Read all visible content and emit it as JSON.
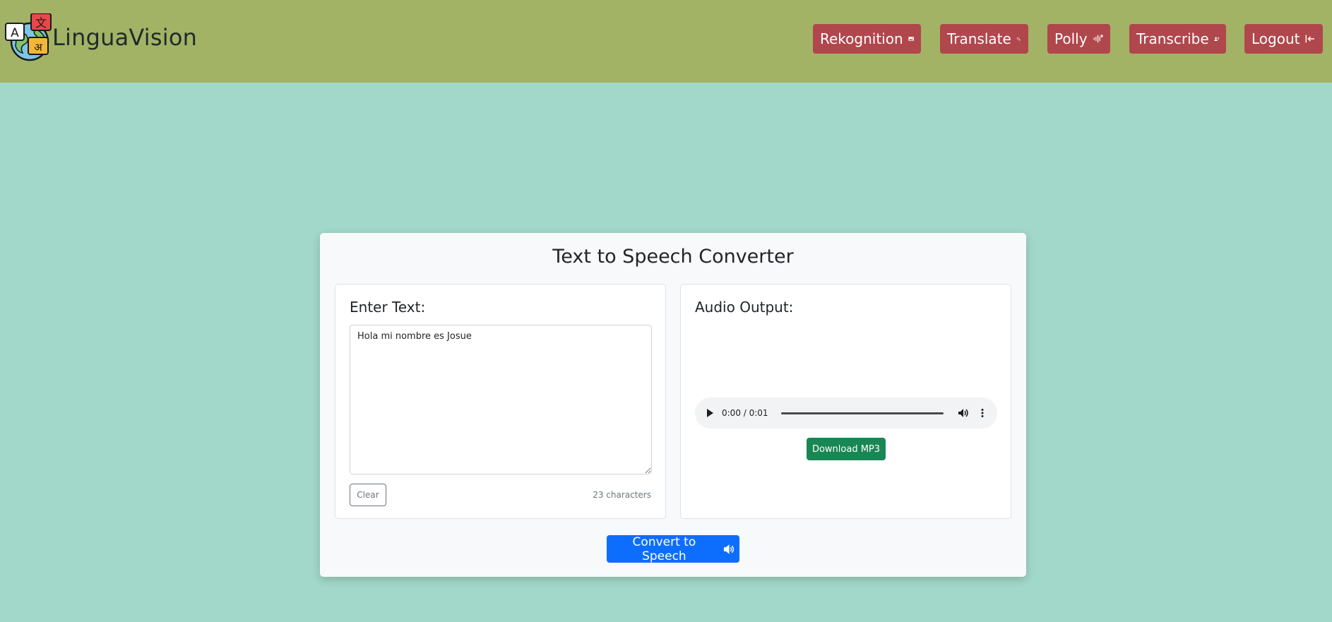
{
  "brand": {
    "name": "LinguaVision"
  },
  "nav": {
    "rekognition_label": "Rekognition",
    "translate_label": "Translate",
    "polly_label": "Polly",
    "transcribe_label": "Transcribe",
    "logout_label": "Logout"
  },
  "card": {
    "title": "Text to Speech Converter",
    "input_heading": "Enter Text:",
    "input_value": "Hola mi nombre es Josue",
    "clear_label": "Clear",
    "char_count": "23 characters",
    "output_heading": "Audio Output:",
    "audio_time": "0:00 / 0:01",
    "download_label": "Download MP3",
    "convert_label": "Convert to Speech"
  },
  "colors": {
    "navbar": "#a3b366",
    "background": "#a2d8c9",
    "nav_button": "#b0474c",
    "download_button": "#198754",
    "convert_button": "#0d6efd"
  },
  "icons": {
    "rekognition": "image-icon",
    "translate": "translate-icon",
    "polly": "soundwave-icon",
    "transcribe": "person-voice-icon",
    "logout": "logout-icon",
    "convert": "volume-up-icon"
  }
}
